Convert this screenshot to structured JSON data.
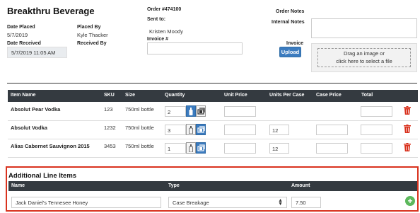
{
  "vendor": "Breakthru Beverage",
  "order": {
    "number": "Order #474100",
    "sent_to_label": "Sent to:",
    "sent_to": "Kristen Moody",
    "invoice_label": "Invoice #",
    "invoice_value": ""
  },
  "details": {
    "date_placed_label": "Date Placed",
    "date_placed": "5/7/2019",
    "placed_by_label": "Placed By",
    "placed_by": "Kyle Thacker",
    "date_received_label": "Date Received",
    "date_received": "5/7/2019 11:05 AM",
    "received_by_label": "Received By"
  },
  "notes": {
    "order_notes_label": "Order Notes",
    "internal_notes_label": "Internal Notes",
    "internal_notes_value": ""
  },
  "invoice_upload": {
    "label": "Invoice",
    "button": "Upload",
    "drop_line1": "Drag an image or",
    "drop_line2": "click here to select a file"
  },
  "table": {
    "headers": {
      "name": "Item Name",
      "sku": "SKU",
      "size": "Size",
      "quantity": "Quantity",
      "unit_price": "Unit Price",
      "units_per_case": "Units Per Case",
      "case_price": "Case Price",
      "total": "Total"
    },
    "rows": [
      {
        "name": "Absolut Pear Vodka",
        "sku": "123",
        "size": "750ml bottle",
        "quantity": "2",
        "unit_mode": "bottle",
        "units_per_case": ""
      },
      {
        "name": "Absolut Vodka",
        "sku": "1232",
        "size": "750ml bottle",
        "quantity": "3",
        "unit_mode": "case",
        "units_per_case": "12"
      },
      {
        "name": "Alias Cabernet Sauvignon 2015",
        "sku": "3453",
        "size": "750ml bottle",
        "quantity": "1",
        "unit_mode": "case",
        "units_per_case": "12"
      }
    ]
  },
  "additional": {
    "title": "Additional Line Items",
    "headers": {
      "name": "Name",
      "type": "Type",
      "amount": "Amount"
    },
    "row": {
      "name": "Jack Daniel's Tennesee Honey",
      "type": "Case Breakage",
      "amount": "7.50"
    }
  },
  "colors": {
    "header_bg": "#343a40",
    "accent_blue": "#3b7bbf",
    "danger": "#d9321e",
    "add_green": "#5cb85c"
  },
  "icons": [
    "bottle-icon",
    "case-icon",
    "trash-icon",
    "plus-circle-icon",
    "select-arrows-icon"
  ]
}
